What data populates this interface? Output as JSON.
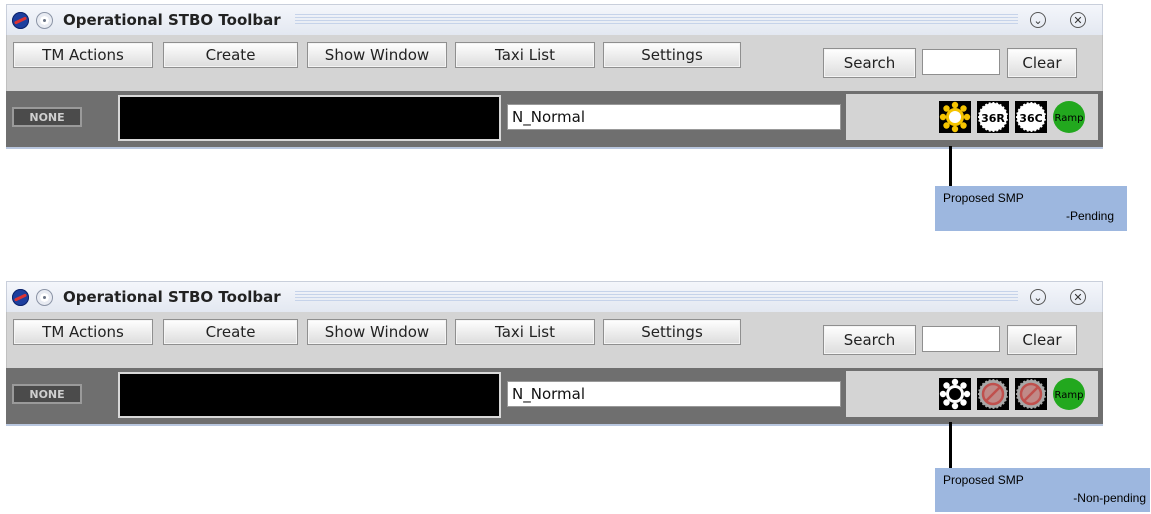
{
  "toolbars": [
    {
      "title": "Operational STBO Toolbar",
      "menu": [
        "TM Actions",
        "Create",
        "Show Window",
        "Taxi List",
        "Settings"
      ],
      "search_label": "Search",
      "clear_label": "Clear",
      "search_value": "",
      "status_badge": "NONE",
      "config_name": "N_Normal",
      "indicators": [
        {
          "icon": "sun-icon",
          "label": "",
          "state": "pending",
          "color": "#f5c400"
        },
        {
          "icon": "runway-36r-icon",
          "label": "36R",
          "state": "active",
          "color": "#ffffff"
        },
        {
          "icon": "runway-36c-icon",
          "label": "36C",
          "state": "active",
          "color": "#ffffff"
        },
        {
          "icon": "ramp-icon",
          "label": "Ramp",
          "state": "open",
          "color": "#22a81e"
        }
      ],
      "callout": {
        "line1": "Proposed SMP",
        "line2": "-Pending"
      }
    },
    {
      "title": "Operational STBO Toolbar",
      "menu": [
        "TM Actions",
        "Create",
        "Show Window",
        "Taxi List",
        "Settings"
      ],
      "search_label": "Search",
      "clear_label": "Clear",
      "search_value": "",
      "status_badge": "NONE",
      "config_name": "N_Normal",
      "indicators": [
        {
          "icon": "sun-icon",
          "label": "",
          "state": "non-pending",
          "color": "#ffffff"
        },
        {
          "icon": "runway-closed-icon",
          "label": "",
          "state": "closed",
          "color": "#c0504d"
        },
        {
          "icon": "runway-closed-icon",
          "label": "",
          "state": "closed",
          "color": "#c0504d"
        },
        {
          "icon": "ramp-icon",
          "label": "Ramp",
          "state": "open",
          "color": "#22a81e"
        }
      ],
      "callout": {
        "line1": "Proposed SMP",
        "line2": "-Non-pending"
      }
    }
  ]
}
